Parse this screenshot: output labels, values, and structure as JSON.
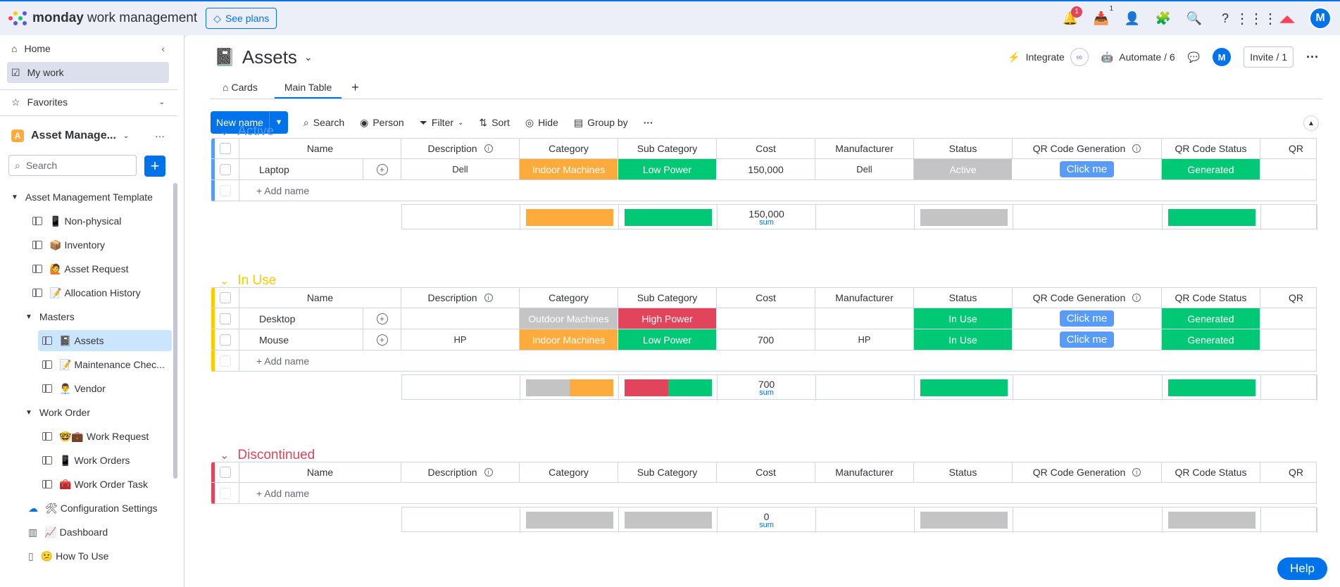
{
  "topbar": {
    "brand": "monday",
    "brand_sub": "work management",
    "see_plans": "See plans",
    "notifications_count": "1",
    "inbox_count": "1",
    "avatar": "M"
  },
  "sidebar": {
    "home": "Home",
    "my_work": "My work",
    "favorites": "Favorites",
    "workspace_badge": "A",
    "workspace_name": "Asset Manage...",
    "search_placeholder": "Search",
    "tree_root": "Asset Management Template",
    "items": [
      {
        "label": "Non-physical",
        "emoji": "📱"
      },
      {
        "label": "Inventory",
        "emoji": "📦"
      },
      {
        "label": "Asset Request",
        "emoji": "🙋"
      },
      {
        "label": "Allocation History",
        "emoji": "📝"
      }
    ],
    "masters": "Masters",
    "masters_items": [
      {
        "label": "Assets",
        "emoji": "📓"
      },
      {
        "label": "Maintenance Chec...",
        "emoji": "📝"
      },
      {
        "label": "Vendor",
        "emoji": "👨‍💼"
      }
    ],
    "work_order": "Work Order",
    "work_order_items": [
      {
        "label": "Work Request",
        "emoji": "🤓💼"
      },
      {
        "label": "Work Orders",
        "emoji": "📱"
      },
      {
        "label": "Work Order Task",
        "emoji": "🧰"
      }
    ],
    "configuration": "Configuration Settings",
    "configuration_emoji": "🛠",
    "dashboard": "Dashboard",
    "dashboard_emoji": "📈",
    "how_to_use": "How To Use",
    "how_to_use_emoji": "😕"
  },
  "board": {
    "title": "Assets",
    "title_emoji": "📓",
    "tabs": [
      "Cards",
      "Main Table"
    ],
    "integrate": "Integrate",
    "automate": "Automate / 6",
    "avatar": "M",
    "invite": "Invite / 1"
  },
  "toolbar": {
    "new_name": "New name",
    "search": "Search",
    "person": "Person",
    "filter": "Filter",
    "sort": "Sort",
    "hide": "Hide",
    "group_by": "Group by"
  },
  "columns": [
    "Name",
    "Description",
    "Category",
    "Sub Category",
    "Cost",
    "Manufacturer",
    "Status",
    "QR Code Generation",
    "QR Code Status",
    "QR"
  ],
  "add_name": "+ Add name",
  "sum_label": "sum",
  "colors": {
    "orange": "#fdab3d",
    "green": "#00c875",
    "grey": "#c4c4c4",
    "red": "#e2445c",
    "blue": "#579bfc",
    "active_group": "#579bfc",
    "inuse_group": "#ffcb00",
    "discontinued_group": "#e2445c"
  },
  "groups": [
    {
      "title": "Active",
      "rows": [
        {
          "name": "Laptop",
          "description": "Dell",
          "category": "Indoor Machines",
          "sub_category": "Low Power",
          "cost": "150,000",
          "manufacturer": "Dell",
          "status": "Active",
          "qr_gen": "Click me",
          "qr_status": "Generated"
        }
      ],
      "sum": "150,000"
    },
    {
      "title": "In Use",
      "rows": [
        {
          "name": "Desktop",
          "description": "",
          "category": "Outdoor Machines",
          "sub_category": "High Power",
          "cost": "",
          "manufacturer": "",
          "status": "In Use",
          "qr_gen": "Click me",
          "qr_status": "Generated"
        },
        {
          "name": "Mouse",
          "description": "HP",
          "category": "Indoor Machines",
          "sub_category": "Low Power",
          "cost": "700",
          "manufacturer": "HP",
          "status": "In Use",
          "qr_gen": "Click me",
          "qr_status": "Generated"
        }
      ],
      "sum": "700"
    },
    {
      "title": "Discontinued",
      "rows": [],
      "sum": "0"
    }
  ],
  "help": "Help"
}
